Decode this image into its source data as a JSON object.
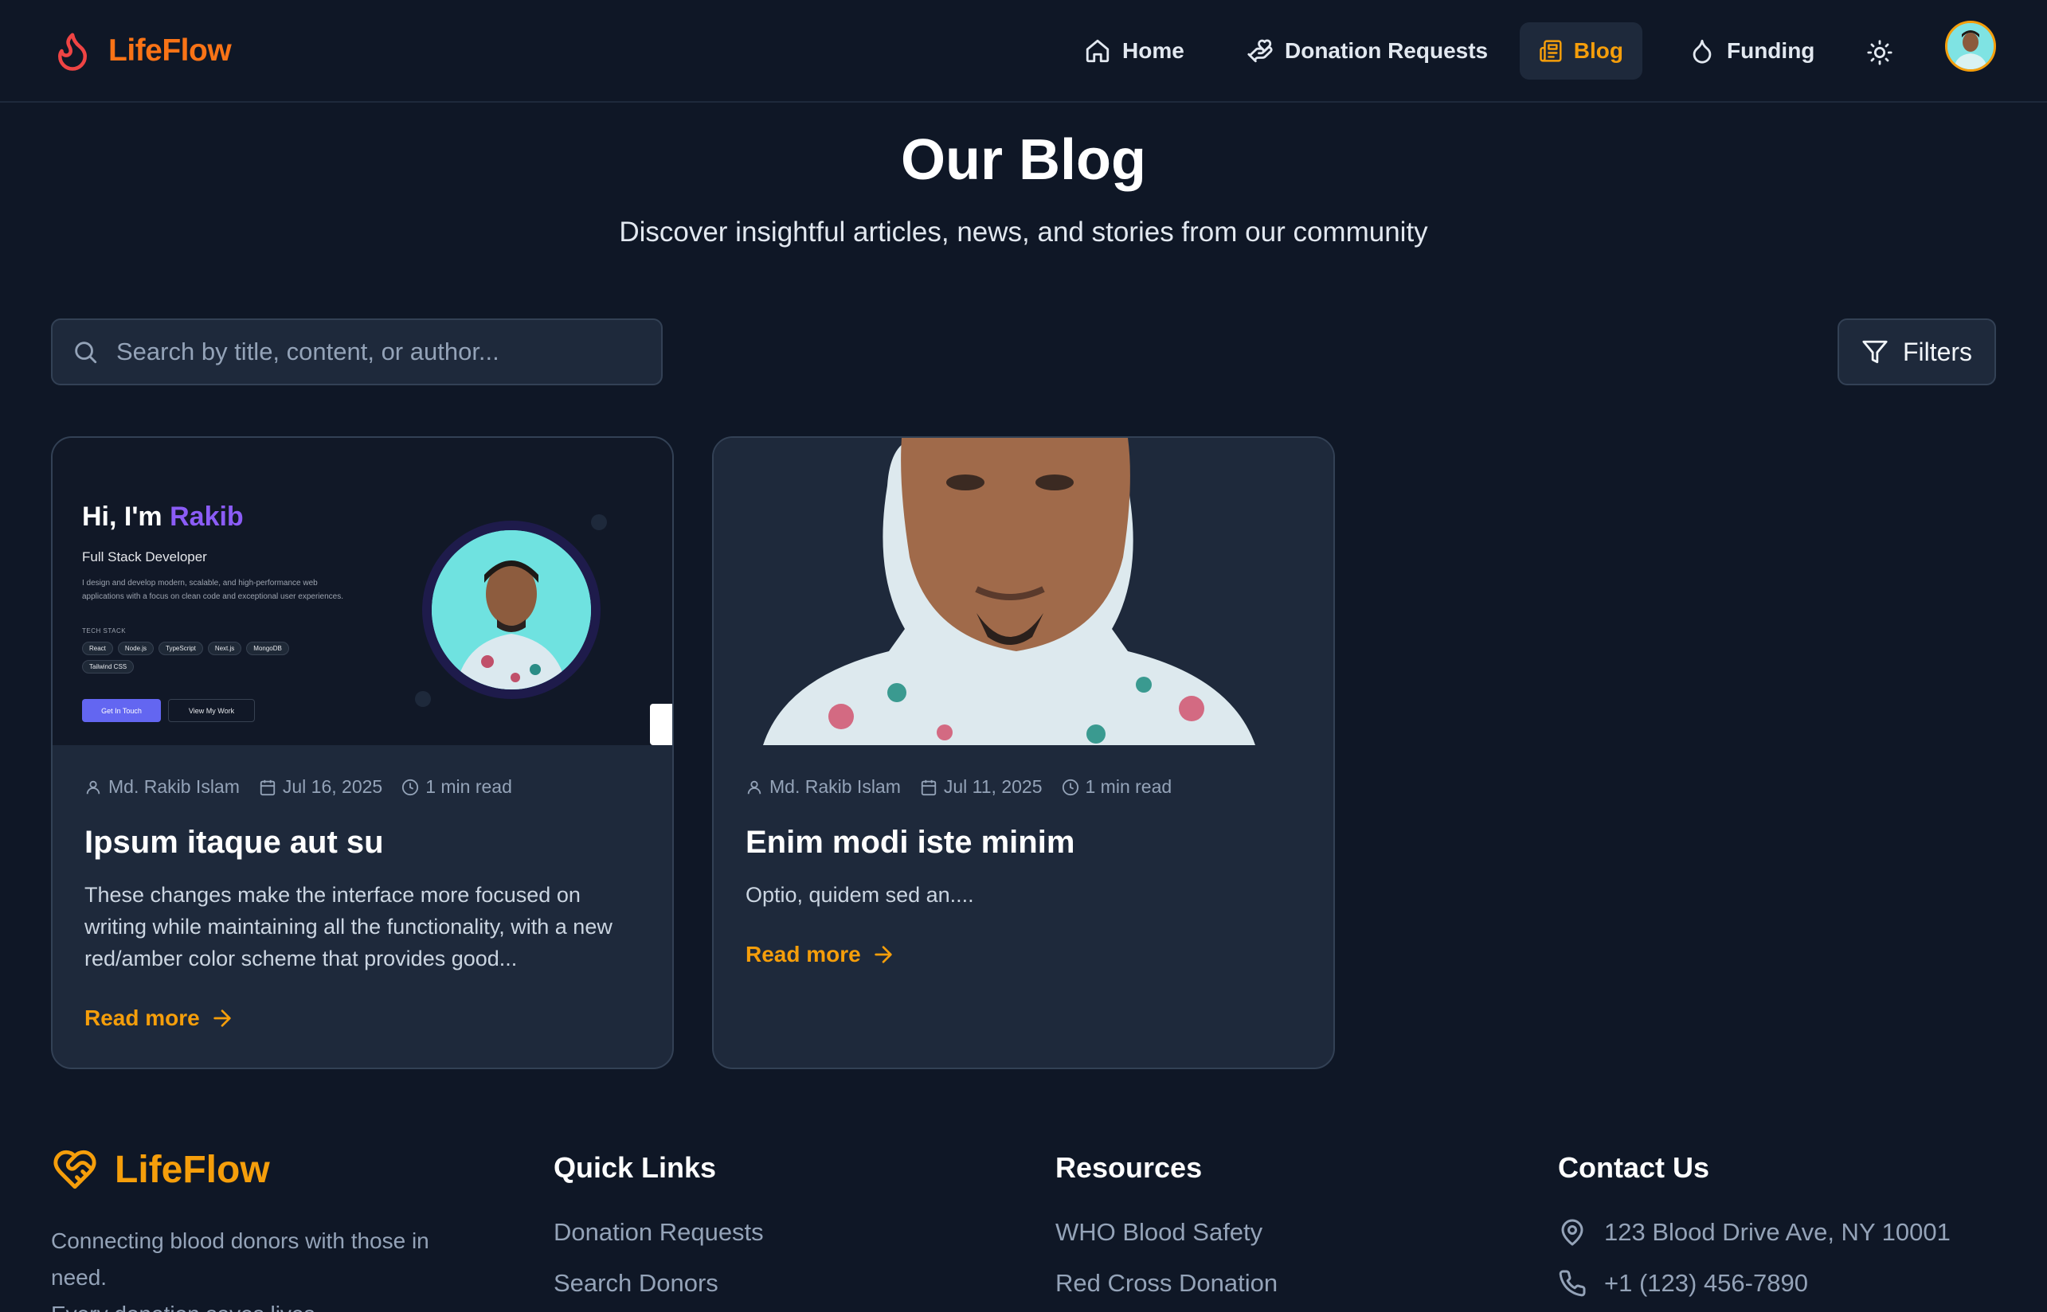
{
  "nav": {
    "brand": "LifeFlow",
    "items": [
      {
        "label": "Home",
        "icon": "home-icon"
      },
      {
        "label": "Donation Requests",
        "icon": "hand-heart-icon"
      },
      {
        "label": "Blog",
        "icon": "newspaper-icon",
        "active": true
      },
      {
        "label": "Funding",
        "icon": "droplet-icon"
      }
    ],
    "theme_icon": "sun-icon",
    "avatar_icon": "user-avatar"
  },
  "hero": {
    "title": "Our Blog",
    "subtitle": "Discover insightful articles, news, and stories from our community"
  },
  "search": {
    "placeholder": "Search by title, content, or author...",
    "value": ""
  },
  "filters": {
    "label": "Filters"
  },
  "posts": [
    {
      "author": "Md. Rakib Islam",
      "date": "Jul 16, 2025",
      "read_time": "1 min read",
      "title": "Ipsum itaque aut su",
      "excerpt": "These changes make the interface more focused on writing while maintaining all the functionality, with a new red/amber color scheme that provides good...",
      "read_more": "Read more",
      "thumb": {
        "hi": "Hi, I'm ",
        "name": "Rakib",
        "role": "Full Stack Developer",
        "desc": "I design and develop modern, scalable, and high-performance web applications with a focus on clean code and exceptional user experiences.",
        "stack_label": "TECH STACK",
        "chips": [
          "React",
          "Node.js",
          "TypeScript",
          "Next.js",
          "MongoDB",
          "Tailwind CSS"
        ],
        "cta_primary": "Get In Touch",
        "cta_secondary": "View My Work"
      }
    },
    {
      "author": "Md. Rakib Islam",
      "date": "Jul 11, 2025",
      "read_time": "1 min read",
      "title": "Enim modi iste minim",
      "excerpt": "Optio, quidem sed an....",
      "read_more": "Read more"
    }
  ],
  "footer": {
    "brand": "LifeFlow",
    "tagline": "Connecting blood donors with those in need.\nEvery donation saves lives.",
    "quick_links": {
      "heading": "Quick Links",
      "links": [
        "Donation Requests",
        "Search Donors"
      ]
    },
    "resources": {
      "heading": "Resources",
      "links": [
        "WHO Blood Safety",
        "Red Cross Donation"
      ]
    },
    "contact": {
      "heading": "Contact Us",
      "address": "123 Blood Drive Ave, NY 10001",
      "phone": "+1 (123) 456-7890"
    }
  },
  "colors": {
    "background": "#0f1726",
    "card": "#1e293b",
    "accent": "#f59e0b",
    "brand_orange": "#f97316"
  }
}
